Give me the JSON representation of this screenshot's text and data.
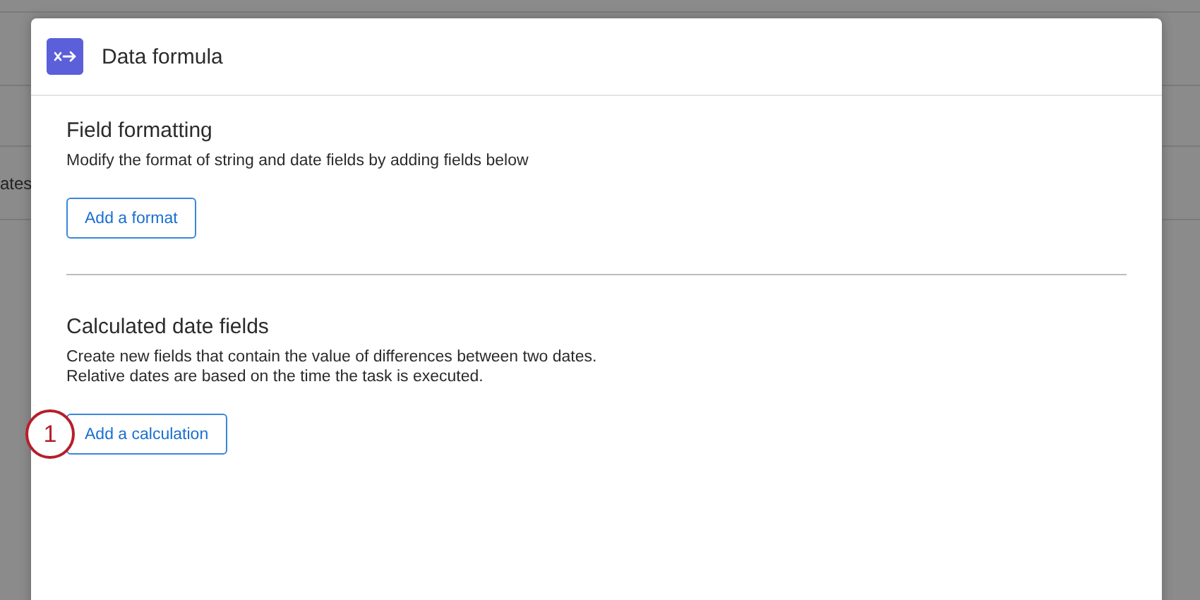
{
  "background": {
    "row_text": "ates"
  },
  "dialog": {
    "title": "Data formula",
    "sections": [
      {
        "heading": "Field formatting",
        "lines": [
          "Modify the format of string and date fields by adding fields below"
        ],
        "button": "Add a format"
      },
      {
        "heading": "Calculated date fields",
        "lines": [
          "Create new fields that contain the value of differences between two dates.",
          "Relative dates are based on the time the task is executed."
        ],
        "button": "Add a calculation",
        "callout": "1"
      }
    ]
  }
}
